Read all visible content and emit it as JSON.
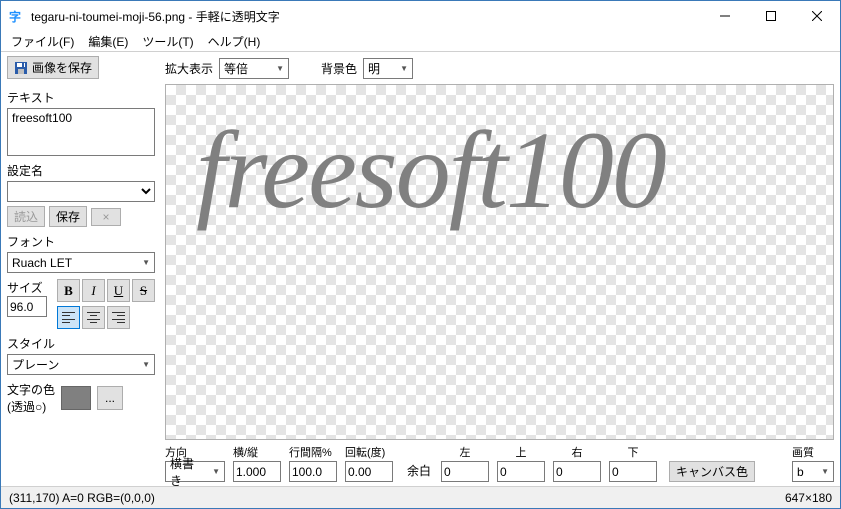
{
  "window": {
    "title": "tegaru-ni-toumei-moji-56.png - 手軽に透明文字"
  },
  "menu": {
    "file": "ファイル(F)",
    "edit": "編集(E)",
    "tool": "ツール(T)",
    "help": "ヘルプ(H)"
  },
  "sidebar": {
    "save_image": "画像を保存",
    "text_label": "テキスト",
    "text_value": "freesoft100",
    "setting_label": "設定名",
    "setting_value": "",
    "load": "読込",
    "save": "保存",
    "clear": "×",
    "font_label": "フォント",
    "font_value": "Ruach LET",
    "size_label": "サイズ",
    "size_value": "96.0",
    "bold": "B",
    "italic": "I",
    "underline": "U",
    "strike": "S",
    "style_label": "スタイル",
    "style_value": "プレーン",
    "color_label_1": "文字の色",
    "color_label_2": "(透過○)",
    "color_value": "#808080",
    "ellipsis": "..."
  },
  "toolbar": {
    "zoom_label": "拡大表示",
    "zoom_value": "等倍",
    "bg_label": "背景色",
    "bg_value": "明"
  },
  "canvas": {
    "text": "freesoft100"
  },
  "bottom": {
    "direction_label": "方向",
    "direction_value": "横書き",
    "ratio_label": "横/縦",
    "ratio_value": "1.000",
    "spacing_label": "行間隔%",
    "spacing_value": "100.0",
    "rotation_label": "回転(度)",
    "rotation_value": "0.00",
    "margin_label": "余白",
    "left_label": "左",
    "left_value": "0",
    "top_label": "上",
    "top_value": "0",
    "right_label": "右",
    "right_value": "0",
    "bottom_label": "下",
    "bottom_value": "0",
    "canvas_color": "キャンバス色",
    "quality_label": "画質",
    "quality_value": "b"
  },
  "status": {
    "left": "(311,170) A=0 RGB=(0,0,0)",
    "right": "647×180"
  }
}
